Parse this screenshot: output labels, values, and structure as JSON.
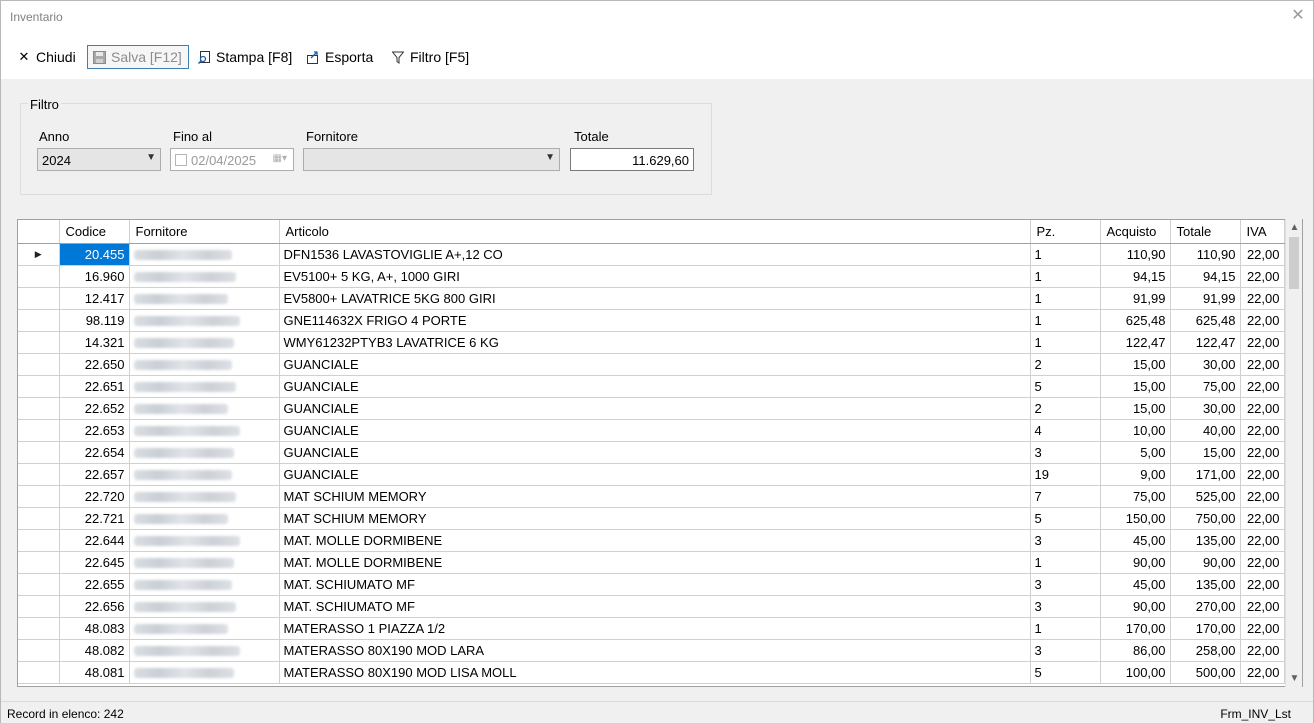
{
  "window": {
    "title": "Inventario"
  },
  "toolbar": {
    "close_label": "Chiudi",
    "save_label": "Salva [F12]",
    "print_label": "Stampa [F8]",
    "export_label": "Esporta",
    "filter_label": "Filtro [F5]"
  },
  "filter": {
    "legend": "Filtro",
    "year_label": "Anno",
    "year_value": "2024",
    "until_label": "Fino al",
    "until_value": "02/04/2025",
    "supplier_label": "Fornitore",
    "supplier_value": "",
    "total_label": "Totale",
    "total_value": "11.629,60"
  },
  "grid": {
    "columns": [
      "Codice",
      "Fornitore",
      "Articolo",
      "Pz.",
      "Acquisto",
      "Totale",
      "IVA"
    ],
    "rows": [
      {
        "codice": "20.455",
        "articolo": "DFN1536 LAVASTOVIGLIE A+,12 CO",
        "pz": "1",
        "acquisto": "110,90",
        "totale": "110,90",
        "iva": "22,00"
      },
      {
        "codice": "16.960",
        "articolo": "EV5100+ 5 KG, A+, 1000 GIRI",
        "pz": "1",
        "acquisto": "94,15",
        "totale": "94,15",
        "iva": "22,00"
      },
      {
        "codice": "12.417",
        "articolo": "EV5800+ LAVATRICE 5KG 800 GIRI",
        "pz": "1",
        "acquisto": "91,99",
        "totale": "91,99",
        "iva": "22,00"
      },
      {
        "codice": "98.119",
        "articolo": "GNE114632X FRIGO 4 PORTE",
        "pz": "1",
        "acquisto": "625,48",
        "totale": "625,48",
        "iva": "22,00"
      },
      {
        "codice": "14.321",
        "articolo": "WMY61232PTYB3 LAVATRICE 6 KG",
        "pz": "1",
        "acquisto": "122,47",
        "totale": "122,47",
        "iva": "22,00"
      },
      {
        "codice": "22.650",
        "articolo": "GUANCIALE",
        "pz": "2",
        "acquisto": "15,00",
        "totale": "30,00",
        "iva": "22,00"
      },
      {
        "codice": "22.651",
        "articolo": "GUANCIALE",
        "pz": "5",
        "acquisto": "15,00",
        "totale": "75,00",
        "iva": "22,00"
      },
      {
        "codice": "22.652",
        "articolo": "GUANCIALE",
        "pz": "2",
        "acquisto": "15,00",
        "totale": "30,00",
        "iva": "22,00"
      },
      {
        "codice": "22.653",
        "articolo": "GUANCIALE",
        "pz": "4",
        "acquisto": "10,00",
        "totale": "40,00",
        "iva": "22,00"
      },
      {
        "codice": "22.654",
        "articolo": "GUANCIALE",
        "pz": "3",
        "acquisto": "5,00",
        "totale": "15,00",
        "iva": "22,00"
      },
      {
        "codice": "22.657",
        "articolo": "GUANCIALE",
        "pz": "19",
        "acquisto": "9,00",
        "totale": "171,00",
        "iva": "22,00"
      },
      {
        "codice": "22.720",
        "articolo": "MAT SCHIUM MEMORY",
        "pz": "7",
        "acquisto": "75,00",
        "totale": "525,00",
        "iva": "22,00"
      },
      {
        "codice": "22.721",
        "articolo": "MAT SCHIUM MEMORY",
        "pz": "5",
        "acquisto": "150,00",
        "totale": "750,00",
        "iva": "22,00"
      },
      {
        "codice": "22.644",
        "articolo": "MAT. MOLLE DORMIBENE",
        "pz": "3",
        "acquisto": "45,00",
        "totale": "135,00",
        "iva": "22,00"
      },
      {
        "codice": "22.645",
        "articolo": "MAT. MOLLE DORMIBENE",
        "pz": "1",
        "acquisto": "90,00",
        "totale": "90,00",
        "iva": "22,00"
      },
      {
        "codice": "22.655",
        "articolo": "MAT. SCHIUMATO MF",
        "pz": "3",
        "acquisto": "45,00",
        "totale": "135,00",
        "iva": "22,00"
      },
      {
        "codice": "22.656",
        "articolo": "MAT. SCHIUMATO MF",
        "pz": "3",
        "acquisto": "90,00",
        "totale": "270,00",
        "iva": "22,00"
      },
      {
        "codice": "48.083",
        "articolo": "MATERASSO 1 PIAZZA 1/2",
        "pz": "1",
        "acquisto": "170,00",
        "totale": "170,00",
        "iva": "22,00"
      },
      {
        "codice": "48.082",
        "articolo": "MATERASSO 80X190 MOD LARA",
        "pz": "3",
        "acquisto": "86,00",
        "totale": "258,00",
        "iva": "22,00"
      },
      {
        "codice": "48.081",
        "articolo": "MATERASSO 80X190 MOD LISA MOLL",
        "pz": "5",
        "acquisto": "100,00",
        "totale": "500,00",
        "iva": "22,00"
      }
    ]
  },
  "status": {
    "records": "Record in elenco: 242",
    "form_name": "Frm_INV_Lst"
  },
  "colors": {
    "selection": "#0078d7",
    "focus_border": "#3c7fb1"
  },
  "icons": [
    "close-icon",
    "save-icon",
    "print-preview-icon",
    "export-icon",
    "filter-icon",
    "chevron-down-icon",
    "calendar-icon",
    "row-pointer-icon"
  ]
}
